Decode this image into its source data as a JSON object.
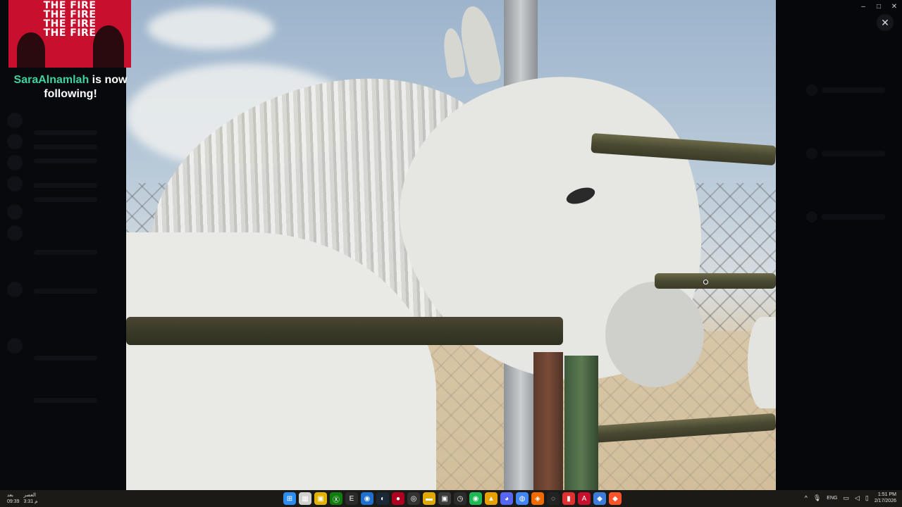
{
  "alert": {
    "banner_lines": [
      "THE FIRE",
      "THE FIRE",
      "THE FIRE",
      "THE FIRE"
    ],
    "username": "SaraAlnamlah",
    "message_suffix": " is now following!"
  },
  "window": {
    "minimize": "–",
    "maximize": "□",
    "close": "✕",
    "viewer_close": "✕"
  },
  "taskbar": {
    "weather_line1": "بعد",
    "weather_line2": "09:39",
    "weather_line3": "العصر",
    "weather_line4": "3:31 م",
    "apps": [
      {
        "name": "start",
        "glyph": "⊞",
        "color": "#2d8cf0"
      },
      {
        "name": "calendar",
        "glyph": "▦",
        "color": "#d0d0d0"
      },
      {
        "name": "notes",
        "glyph": "▣",
        "color": "#e2b400"
      },
      {
        "name": "xbox",
        "glyph": "Ⓧ",
        "color": "#107c10"
      },
      {
        "name": "epic",
        "glyph": "E",
        "color": "#2a2a2a"
      },
      {
        "name": "app-blue",
        "glyph": "◉",
        "color": "#1f6fd1"
      },
      {
        "name": "steam",
        "glyph": "◐",
        "color": "#1b2838"
      },
      {
        "name": "app-red",
        "glyph": "●",
        "color": "#b00020"
      },
      {
        "name": "obs",
        "glyph": "◎",
        "color": "#333"
      },
      {
        "name": "files",
        "glyph": "▬",
        "color": "#e0a800"
      },
      {
        "name": "terminal",
        "glyph": "▣",
        "color": "#3a3a3a"
      },
      {
        "name": "clock",
        "glyph": "◷",
        "color": "#2b2b2b"
      },
      {
        "name": "spotify",
        "glyph": "◉",
        "color": "#1db954"
      },
      {
        "name": "app-yellow",
        "glyph": "▲",
        "color": "#e8a000"
      },
      {
        "name": "discord",
        "glyph": "◕",
        "color": "#5865f2"
      },
      {
        "name": "chrome",
        "glyph": "◍",
        "color": "#4285f4"
      },
      {
        "name": "app-orange",
        "glyph": "◈",
        "color": "#f06a00"
      },
      {
        "name": "app-circle",
        "glyph": "◌",
        "color": "#222"
      },
      {
        "name": "app-red2",
        "glyph": "▮",
        "color": "#e03030"
      },
      {
        "name": "app-a",
        "glyph": "A",
        "color": "#c8102e"
      },
      {
        "name": "shield",
        "glyph": "◆",
        "color": "#3b7dd8"
      },
      {
        "name": "brave",
        "glyph": "◆",
        "color": "#fb542b"
      }
    ],
    "tray": {
      "chevron": "^",
      "language": "ENG",
      "time": "1:51 PM",
      "date": "2/17/2026"
    }
  }
}
